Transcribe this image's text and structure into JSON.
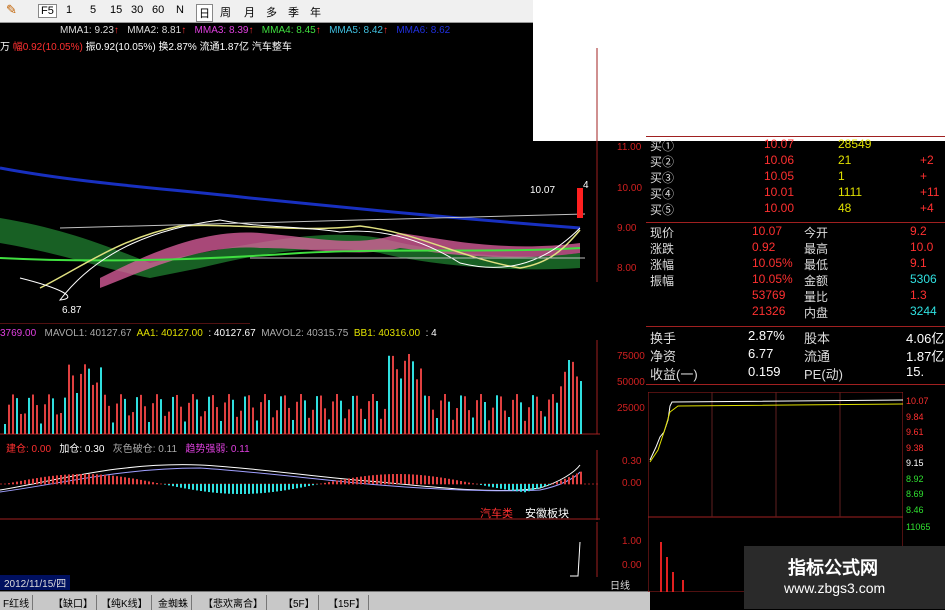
{
  "toolbar": {
    "f5_label": "F5",
    "periods": [
      "1",
      "5",
      "15",
      "30",
      "60",
      "N"
    ],
    "day_label": "日",
    "week_label": "周",
    "month_label": "月",
    "multi_label": "多",
    "season_label": "季",
    "year_label": "年"
  },
  "ma_line": {
    "mma1": "MMA1: 9.23",
    "mma2": "MMA2: 8.81",
    "mma3": "MMA3: 8.39",
    "mma4": "MMA4: 8.45",
    "mma5": "MMA5: 8.42",
    "mma6": "MMA6: 8.62"
  },
  "info_line": {
    "prefix": "万",
    "change": "幅0.92(10.05%)",
    "amplitude": "振0.92(10.05%)",
    "turnover": "换2.87%",
    "float": "流通1.87亿",
    "sector": "汽车整车"
  },
  "price_axis": [
    "11.00",
    "10.00",
    "9.00",
    "8.00"
  ],
  "annotations": {
    "high": "10.07",
    "low": "6.87",
    "marker": "4"
  },
  "volume_line": {
    "left": "3769.00",
    "mavol1": "MAVOL1: 40127.67",
    "aa1": "AA1: 40127.00",
    "val": ": 40127.67",
    "mavol2": "MAVOL2: 40315.75",
    "bb1": "BB1: 40316.00",
    "end": ": 4"
  },
  "volume_axis": [
    "75000",
    "50000",
    "25000"
  ],
  "macd_line": {
    "a": "建仓: 0.00",
    "b": "加仓: 0.30",
    "c": "灰色破仓: 0.11",
    "d": "趋势强弱: 0.11"
  },
  "macd_axis": [
    "0.30",
    "0.00"
  ],
  "sector_labels": {
    "auto": "汽车类",
    "anhui": "安徽板块"
  },
  "bottom_axis": [
    "1.00",
    "0.00"
  ],
  "date_label": "2012/11/15/四",
  "period_label": "日线",
  "bottom_tabs": [
    "F红线",
    "【缺口】",
    "【纯K线】",
    "金蜘蛛",
    "【悲欢离合】",
    "【5F】",
    "【15F】"
  ],
  "quote": {
    "bids": [
      {
        "label": "买①",
        "price": "10.07",
        "vol": "28549",
        "chg": ""
      },
      {
        "label": "买②",
        "price": "10.06",
        "vol": "21",
        "chg": "+2"
      },
      {
        "label": "买③",
        "price": "10.05",
        "vol": "1",
        "chg": "+"
      },
      {
        "label": "买④",
        "price": "10.01",
        "vol": "1111",
        "chg": "+11"
      },
      {
        "label": "买⑤",
        "price": "10.00",
        "vol": "48",
        "chg": "+4"
      }
    ],
    "stats": [
      {
        "l1": "现价",
        "v1": "10.07",
        "l2": "今开",
        "v2": "9.2"
      },
      {
        "l1": "涨跌",
        "v1": "0.92",
        "l2": "最高",
        "v2": "10.0"
      },
      {
        "l1": "涨幅",
        "v1": "10.05%",
        "l2": "最低",
        "v2": "9.1"
      },
      {
        "l1": "振幅",
        "v1": "10.05%",
        "l2": "金额",
        "v2": "5306"
      },
      {
        "l1": "",
        "v1": "53769",
        "l2": "量比",
        "v2": "1.3"
      },
      {
        "l1": "",
        "v1": "21326",
        "l2": "内盘",
        "v2": "3244"
      }
    ],
    "extra": [
      {
        "l1": "换手",
        "v1": "2.87%",
        "l2": "股本",
        "v2": "4.06亿"
      },
      {
        "l1": "净资",
        "v1": "6.77",
        "l2": "流通",
        "v2": "1.87亿"
      },
      {
        "l1": "收益(一)",
        "v1": "0.159",
        "l2": "PE(动)",
        "v2": "15."
      }
    ]
  },
  "intraday_axis": [
    "10.07",
    "9.84",
    "9.61",
    "9.38",
    "9.15",
    "8.92",
    "8.69",
    "8.46",
    "11065"
  ],
  "watermark": {
    "title": "指标公式网",
    "url": "www.zbgs3.com"
  }
}
